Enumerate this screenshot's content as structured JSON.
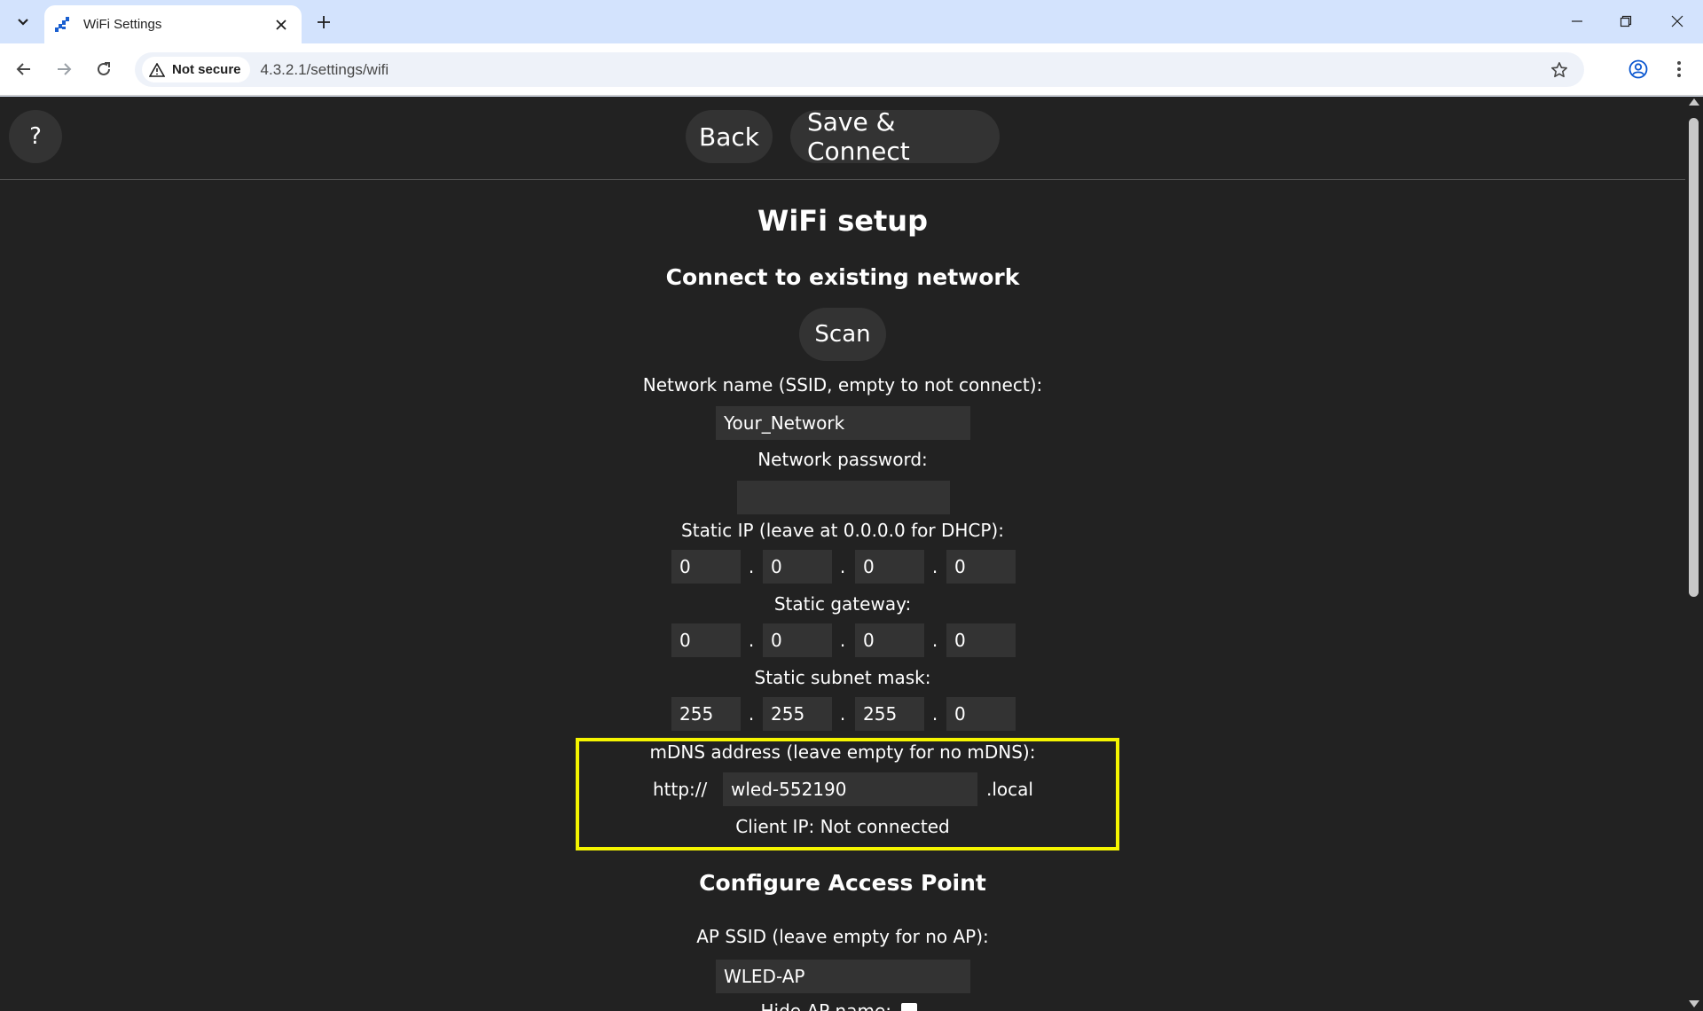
{
  "browser": {
    "tab_title": "WiFi Settings",
    "security_label": "Not secure",
    "url": "4.3.2.1/settings/wifi"
  },
  "header": {
    "help_label": "?",
    "back_label": "Back",
    "save_label": "Save & Connect"
  },
  "main": {
    "title": "WiFi setup",
    "connect_heading": "Connect to existing network",
    "scan_label": "Scan",
    "ssid_label": "Network name (SSID, empty to not connect):",
    "ssid_value": "Your_Network",
    "password_label": "Network password:",
    "password_value": "",
    "static_ip": {
      "label": "Static IP (leave at 0.0.0.0 for DHCP):",
      "octets": [
        "0",
        "0",
        "0",
        "0"
      ]
    },
    "gateway": {
      "label": "Static gateway:",
      "octets": [
        "0",
        "0",
        "0",
        "0"
      ]
    },
    "subnet": {
      "label": "Static subnet mask:",
      "octets": [
        "255",
        "255",
        "255",
        "0"
      ]
    },
    "mdns": {
      "label": "mDNS address (leave empty for no mDNS):",
      "prefix": "http://",
      "value": "wled-552190",
      "suffix": ".local"
    },
    "client_ip_text": "Client IP: Not connected",
    "ap_heading": "Configure Access Point",
    "ap_ssid_label": "AP SSID (leave empty for no AP):",
    "ap_ssid_value": "WLED-AP",
    "hide_ap_label": "Hide AP name:"
  },
  "colors": {
    "page_bg": "#222222",
    "control_bg": "#333333",
    "highlight": "#f5f500",
    "tabstrip_bg": "#d3e3fd"
  }
}
